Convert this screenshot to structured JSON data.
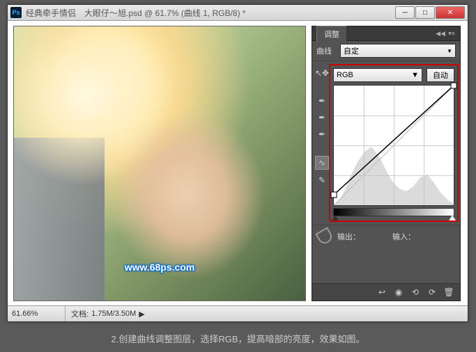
{
  "titlebar": {
    "ps": "Ps",
    "title": "经典牵手情侣　大眼仔～旭.psd @ 61.7% (曲线 1, RGB/8) *"
  },
  "panel": {
    "tab": "调整",
    "preset_label": "曲线",
    "preset_value": "自定",
    "channel_value": "RGB",
    "auto": "自动",
    "output_label": "输出：",
    "input_label": "输入："
  },
  "chart_data": {
    "type": "line",
    "title": "Curves",
    "xlabel": "Input",
    "ylabel": "Output",
    "xlim": [
      0,
      255
    ],
    "ylim": [
      0,
      255
    ],
    "series": [
      {
        "name": "RGB curve",
        "points": [
          [
            0,
            22
          ],
          [
            255,
            255
          ]
        ]
      }
    ],
    "histogram_shape": "low-mid heavy, peak near 30%, secondary bump near 75%",
    "grid": "4x4"
  },
  "status": {
    "zoom": "61.66%",
    "doc_label": "文档:",
    "doc_value": "1.75M/3.50M"
  },
  "watermark": "www.68ps.com",
  "caption": "2.创建曲线调整图层，选择RGB，提高暗部的亮度，效果如图。"
}
